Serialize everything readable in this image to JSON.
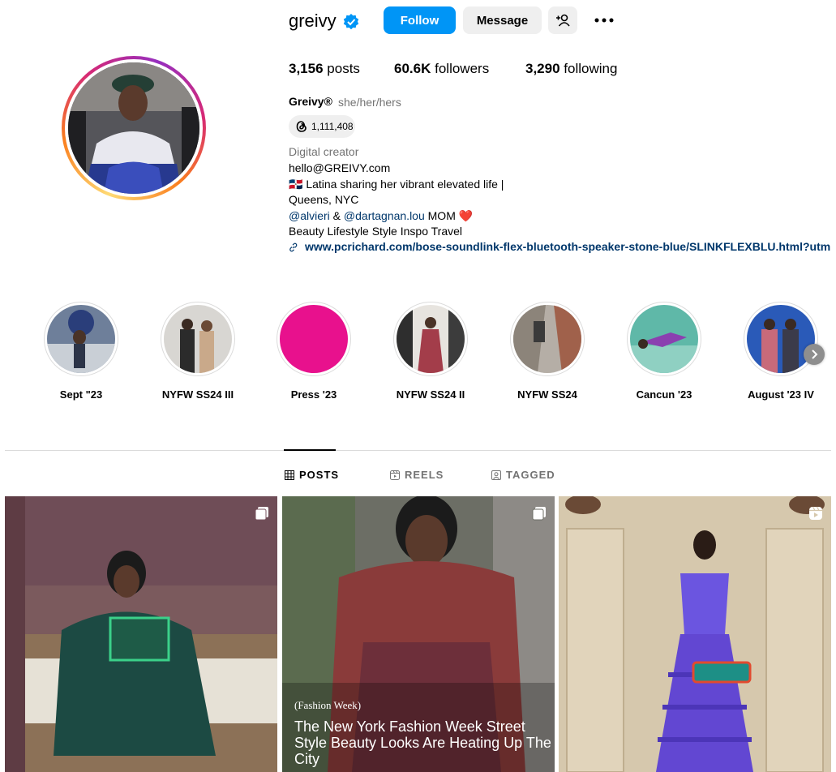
{
  "profile": {
    "username": "greivy",
    "follow_label": "Follow",
    "message_label": "Message",
    "add_user_label": "+",
    "stats": {
      "posts_count": "3,156",
      "posts_label": "posts",
      "followers_count": "60.6K",
      "followers_label": "followers",
      "following_count": "3,290",
      "following_label": "following"
    },
    "display_name": "Greivy®",
    "pronouns": "she/her/hers",
    "threads_count": "1,111,408",
    "category": "Digital creator",
    "bio_email": "hello@GREIVY.com",
    "bio_line2": "🇩🇴 Latina sharing her vibrant elevated life |",
    "bio_line3": "Queens, NYC",
    "mention1": "@alvieri",
    "mention_and": " & ",
    "mention2": "@dartagnan.lou",
    "mention_suffix": " MOM ❤️",
    "bio_line5": "Beauty Lifestyle Style Inspo Travel",
    "link": "www.pcrichard.com/bose-soundlink-flex-bluetooth-speaker-stone-blue/SLINKFLEXBLU.html?utm"
  },
  "highlights": [
    {
      "label": "Sept \"23"
    },
    {
      "label": "NYFW SS24 III"
    },
    {
      "label": "Press '23"
    },
    {
      "label": "NYFW SS24 II"
    },
    {
      "label": "NYFW SS24"
    },
    {
      "label": "Cancun '23"
    },
    {
      "label": "August '23 IV"
    }
  ],
  "tabs": {
    "posts": "POSTS",
    "reels": "REELS",
    "tagged": "TAGGED"
  },
  "posts": [
    {
      "type": "carousel"
    },
    {
      "type": "carousel",
      "tag": "(Fashion Week)",
      "caption": "The New York Fashion Week Street Style Beauty Looks Are Heating Up The City"
    },
    {
      "type": "reel"
    }
  ],
  "colors": {
    "accent": "#0095f6",
    "link": "#00376b",
    "muted": "#737373",
    "button_bg": "#efefef",
    "press_highlight": "#e8118d"
  }
}
